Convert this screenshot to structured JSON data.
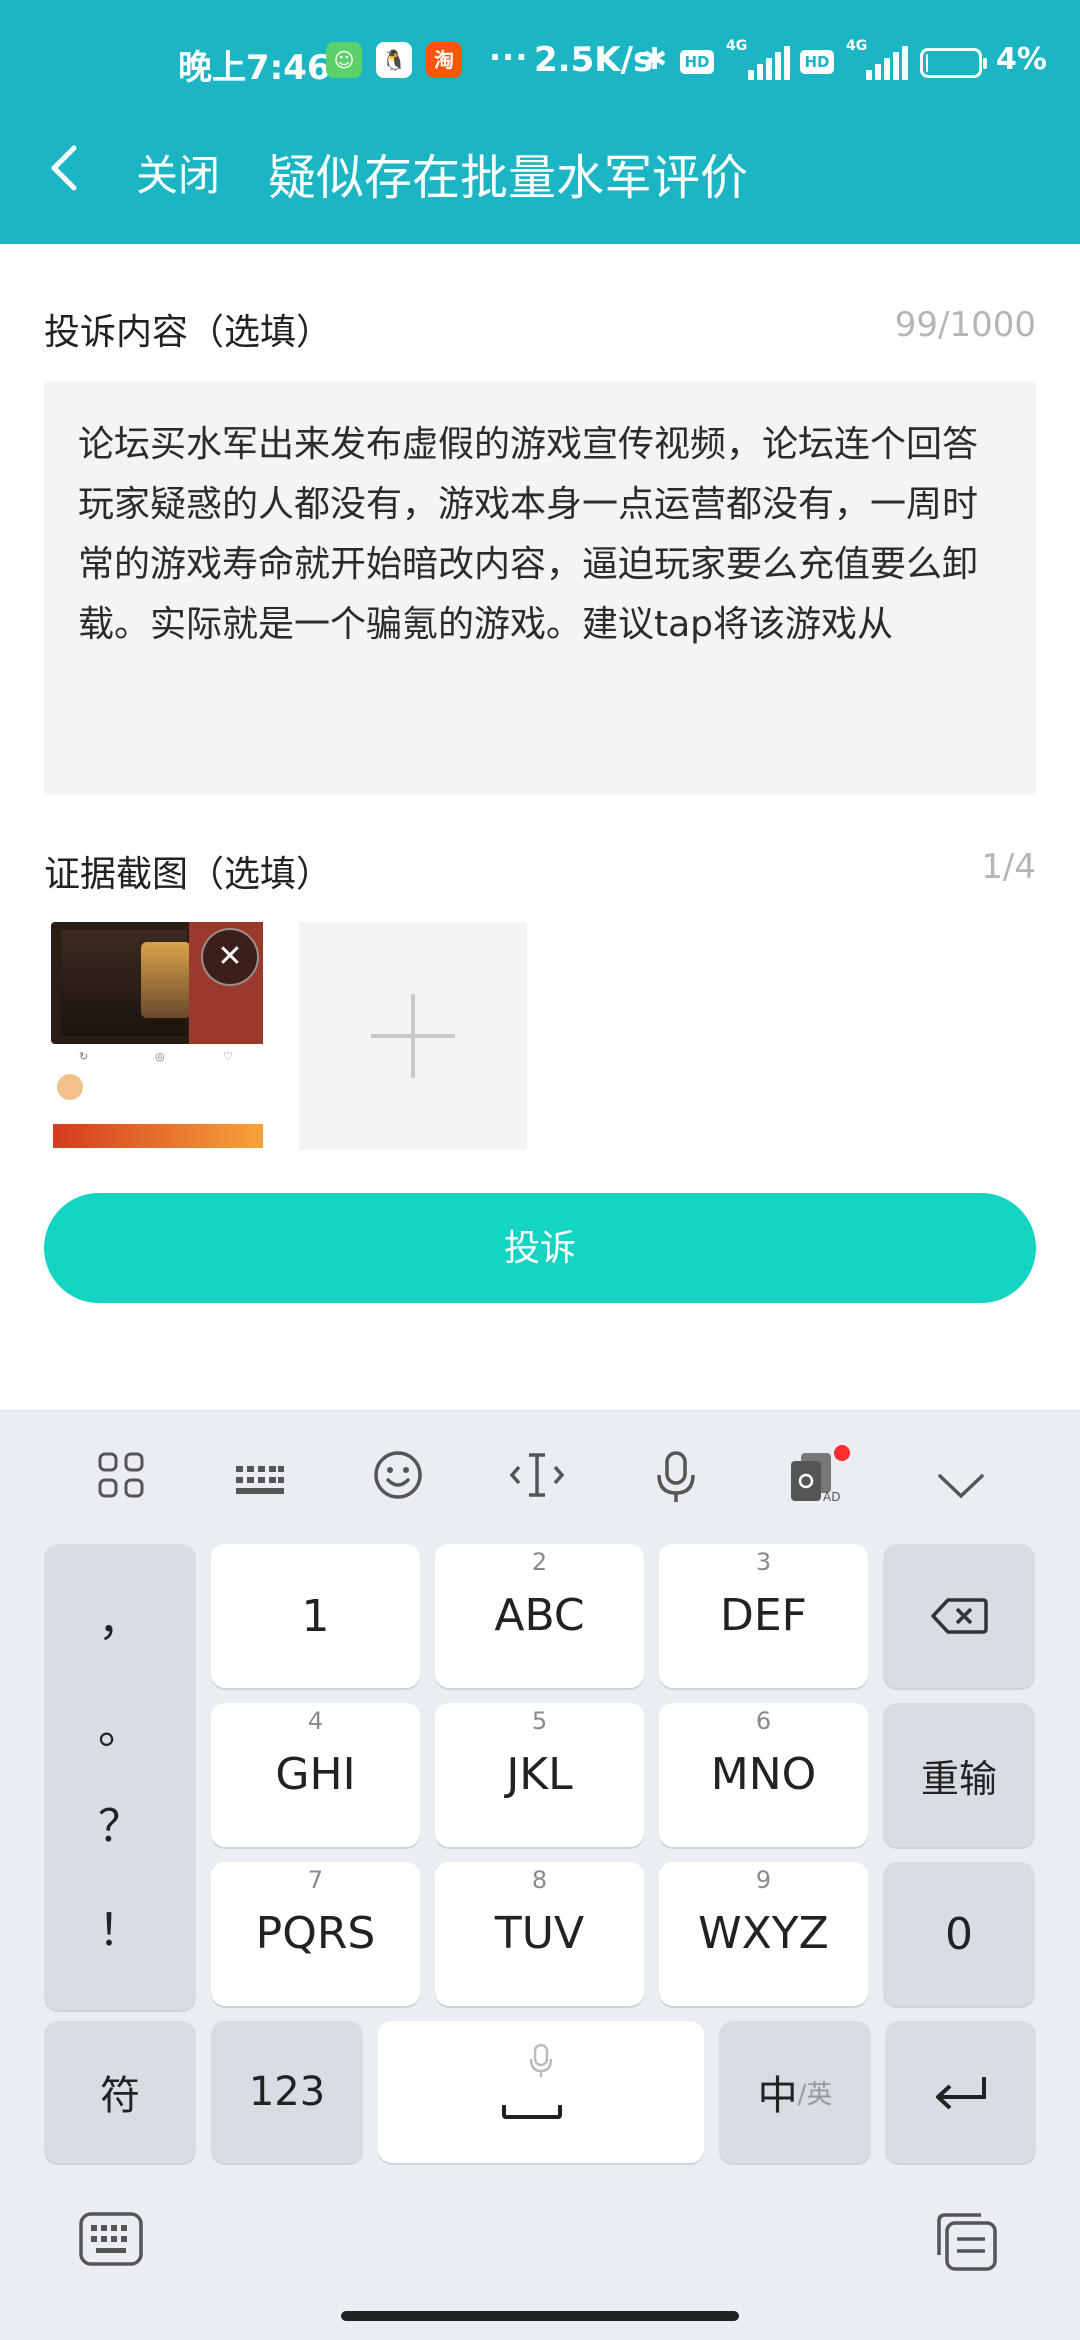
{
  "status_bar": {
    "time": "晚上7:46",
    "app_icons": [
      "wechat-icon",
      "qq-icon",
      "taobao-icon"
    ],
    "more": "···",
    "net_speed": "2.5K/s",
    "hd_label": "HD",
    "network_label": "4G",
    "battery_percent": 4,
    "battery_text": "4%"
  },
  "title_bar": {
    "back_icon": "chevron-left-icon",
    "close_label": "关闭",
    "title": "疑似存在批量水军评价"
  },
  "complaint": {
    "label": "投诉内容（选填）",
    "count": "99/1000",
    "text": "论坛买水军出来发布虚假的游戏宣传视频，论坛连个回答玩家疑惑的人都没有，游戏本身一点运营都没有，一周时常的游戏寿命就开始暗改内容，逼迫玩家要么充值要么卸载。实际就是一个骗氪的游戏。建议tap将该游戏从"
  },
  "evidence": {
    "label": "证据截图（选填）",
    "count": "1/4"
  },
  "submit_label": "投诉",
  "keyboard": {
    "toolbar": [
      "grid-icon",
      "keyboard-icon",
      "emoji-icon",
      "cursor-icon",
      "mic-icon",
      "skin-icon",
      "chevron-down-icon"
    ],
    "punctuation": [
      "，",
      "。",
      "？",
      "！"
    ],
    "keys": [
      {
        "num": "",
        "main": "1"
      },
      {
        "num": "2",
        "main": "ABC"
      },
      {
        "num": "3",
        "main": "DEF"
      },
      {
        "num": "4",
        "main": "GHI"
      },
      {
        "num": "5",
        "main": "JKL"
      },
      {
        "num": "6",
        "main": "MNO"
      },
      {
        "num": "7",
        "main": "PQRS"
      },
      {
        "num": "8",
        "main": "TUV"
      },
      {
        "num": "9",
        "main": "WXYZ"
      }
    ],
    "reinput": "重输",
    "zero": "0",
    "symbols": "符",
    "numbers": "123",
    "lang_main": "中",
    "lang_alt": "/英",
    "backspace_icon": "backspace-icon",
    "enter_icon": "enter-icon",
    "accent": "#16d4c2"
  },
  "theme": {
    "header_bg": "#1cb5c4",
    "button_bg": "#16d4c2"
  }
}
